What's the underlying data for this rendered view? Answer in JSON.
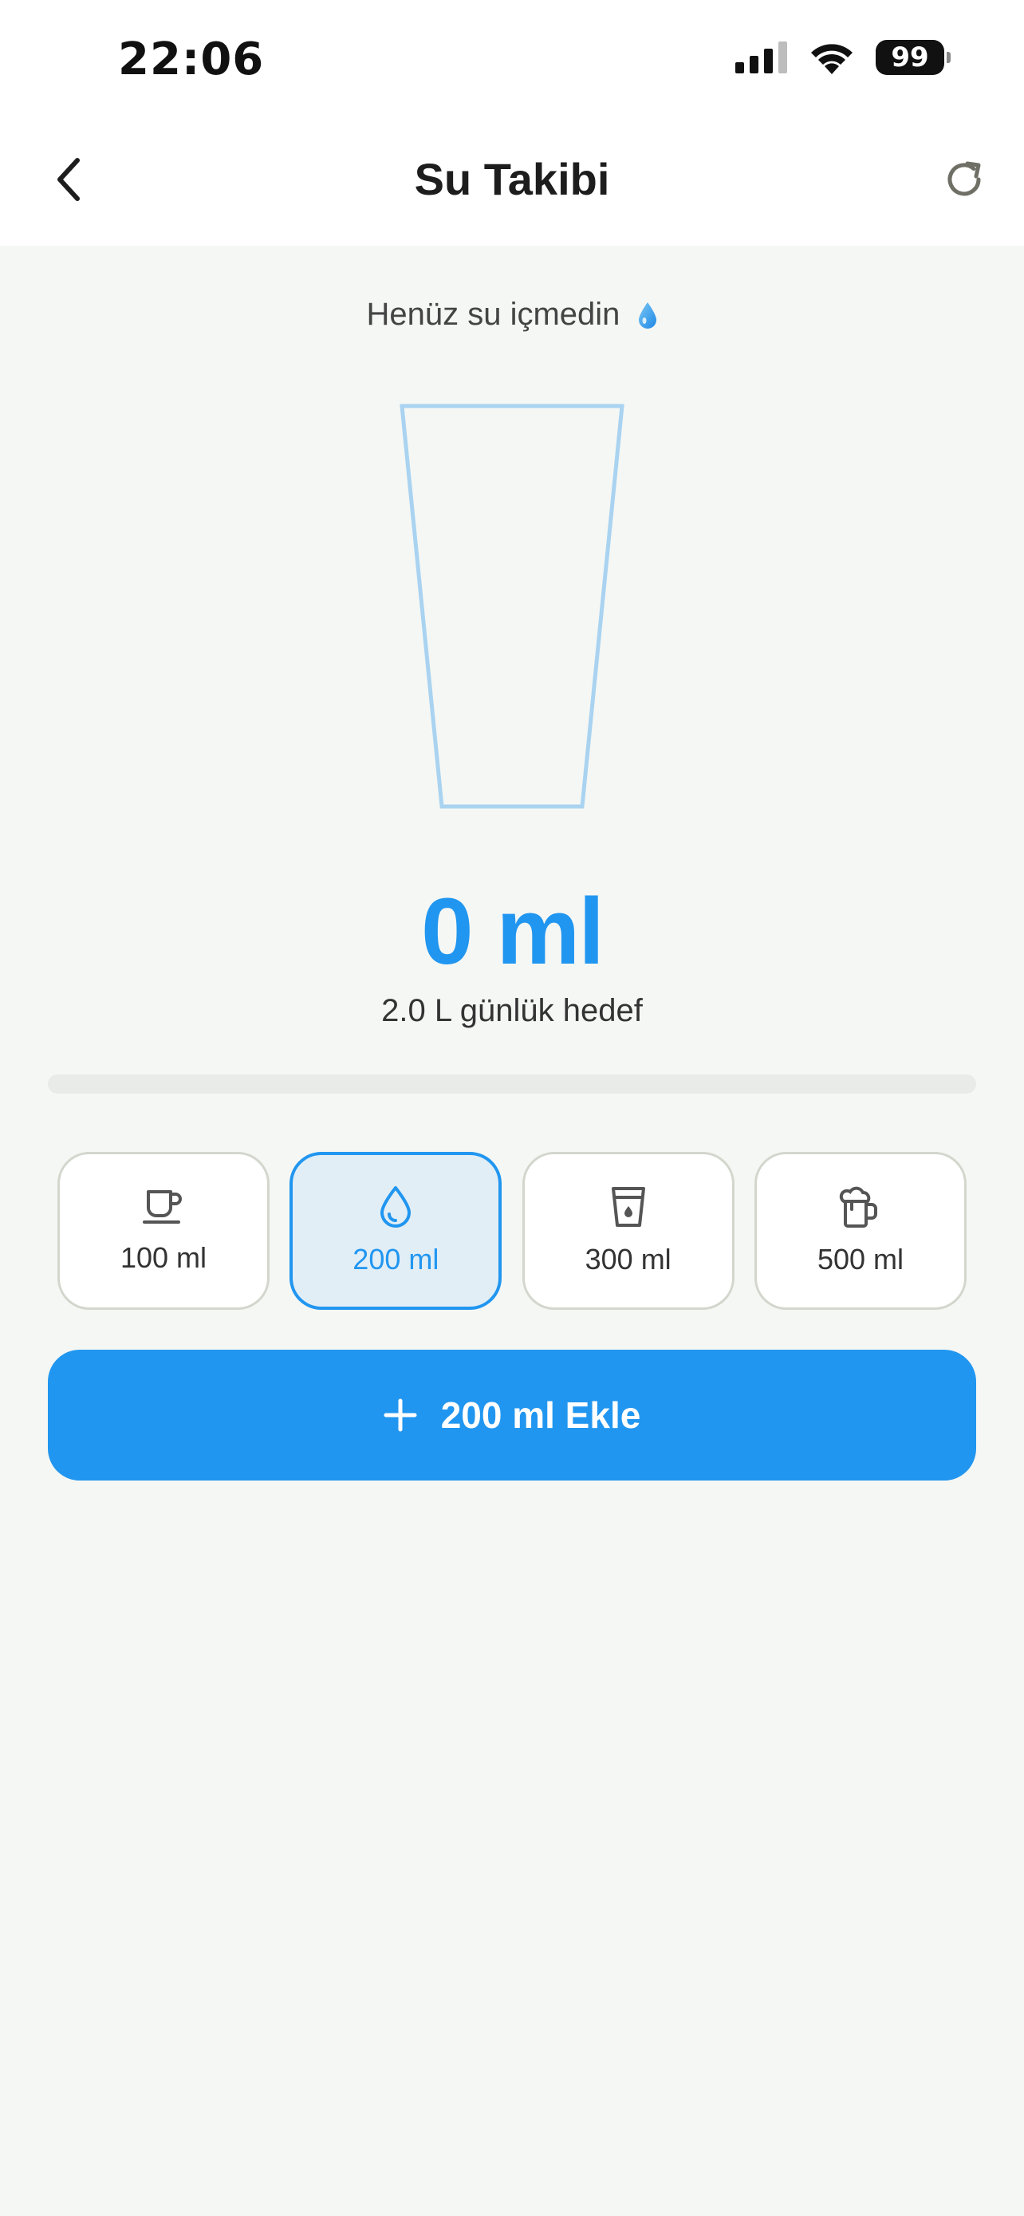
{
  "status_bar": {
    "time": "22:06",
    "battery": "99"
  },
  "header": {
    "title": "Su Takibi",
    "back_icon": "chevron-left-icon",
    "refresh_icon": "refresh-icon"
  },
  "hint": {
    "text": "Henüz su içmedin",
    "icon": "water-drop-icon"
  },
  "intake": {
    "amount": "0 ml",
    "goal_text": "2.0 L günlük hedef",
    "progress_fraction": 0.0
  },
  "options": [
    {
      "label": "100 ml",
      "icon": "coffee-cup-icon",
      "selected": false
    },
    {
      "label": "200 ml",
      "icon": "water-drop-icon",
      "selected": true
    },
    {
      "label": "300 ml",
      "icon": "water-glass-icon",
      "selected": false
    },
    {
      "label": "500 ml",
      "icon": "beer-mug-icon",
      "selected": false
    }
  ],
  "add_button": {
    "label": "200 ml Ekle",
    "icon": "plus-icon"
  },
  "colors": {
    "accent": "#2196f0",
    "background": "#f5f7f4",
    "glass_outline": "#a9d3f0"
  }
}
